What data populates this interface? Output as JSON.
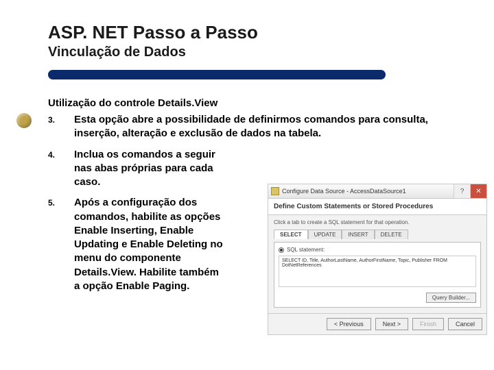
{
  "title": "ASP. NET Passo a Passo",
  "subtitle": "Vinculação de Dados",
  "section_heading": "Utilização do controle Details.View",
  "items": [
    {
      "num": "3.",
      "text": "Esta opção abre a possibilidade de definirmos comandos para consulta, inserção, alteração e exclusão de dados na tabela."
    },
    {
      "num": "4.",
      "text": "Inclua os comandos a seguir nas abas próprias para cada caso."
    },
    {
      "num": "5.",
      "text": "Após a configuração dos comandos, habilite as opções Enable Inserting, Enable Updating e Enable Deleting no menu do componente Details.View. Habilite também a opção Enable Paging."
    }
  ],
  "wizard": {
    "window_title": "Configure Data Source - AccessDataSource1",
    "header": "Define Custom Statements or Stored Procedures",
    "helper": "Click a tab to create a SQL statement for that operation.",
    "tabs": [
      "SELECT",
      "UPDATE",
      "INSERT",
      "DELETE"
    ],
    "radio_label": "SQL statement:",
    "sql": "SELECT ID, Title, AuthorLastName, AuthorFirstName, Topic, Publisher FROM DotNetReferences",
    "query_builder": "Query Builder...",
    "footer": {
      "prev": "< Previous",
      "next": "Next >",
      "finish": "Finish",
      "cancel": "Cancel"
    }
  }
}
